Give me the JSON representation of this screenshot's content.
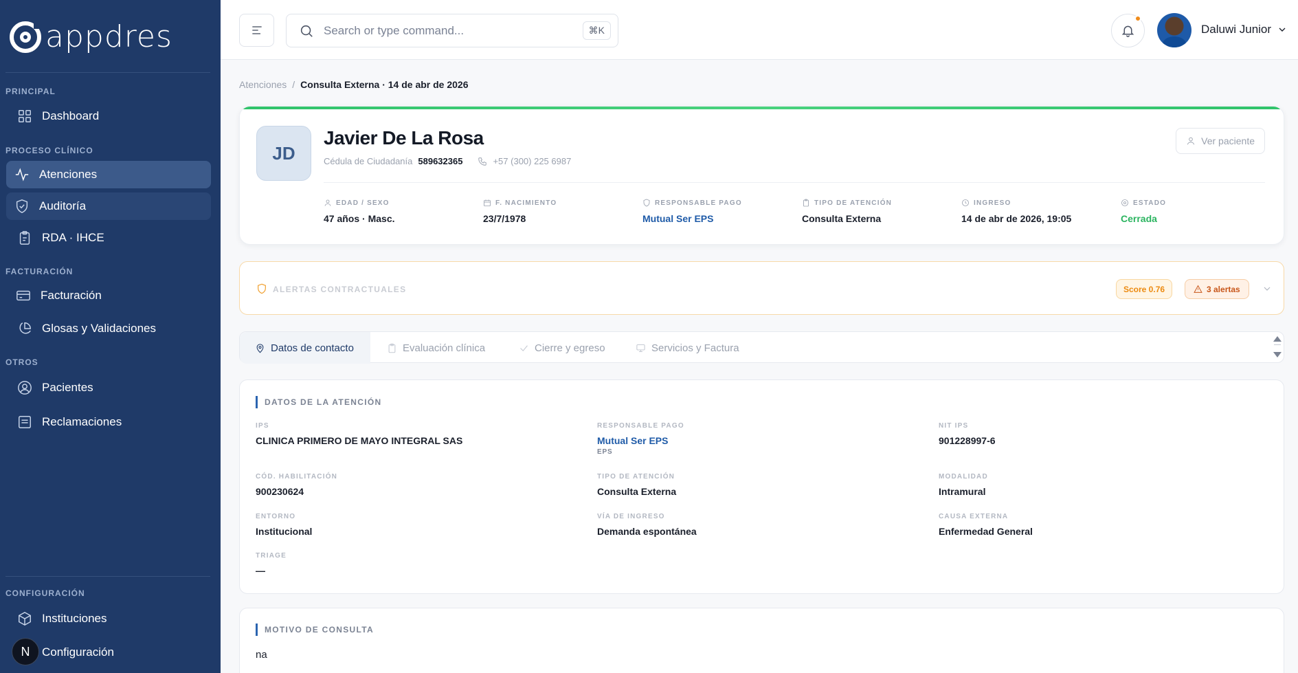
{
  "app": {
    "name": "appdres"
  },
  "sidebar": {
    "sections": {
      "principal": "PRINCIPAL",
      "proceso": "PROCESO CLÍNICO",
      "facturacion": "FACTURACIÓN",
      "otros": "OTROS",
      "config": "CONFIGURACIÓN"
    },
    "items": {
      "dashboard": "Dashboard",
      "atenciones": "Atenciones",
      "auditoria": "Auditoría",
      "rda": "RDA · IHCE",
      "facturacion": "Facturación",
      "glosas": "Glosas y Validaciones",
      "pacientes": "Pacientes",
      "reclamaciones": "Reclamaciones",
      "instituciones": "Instituciones",
      "configuracion": "Configuración"
    },
    "n_badge": "N"
  },
  "topbar": {
    "search_placeholder": "Search or type command...",
    "shortcut": "⌘K",
    "user_name": "Daluwi Junior"
  },
  "breadcrumb": {
    "parent": "Atenciones",
    "separator": "/",
    "current": "Consulta Externa · 14 de abr de 2026"
  },
  "patient": {
    "initials": "JD",
    "name": "Javier De La Rosa",
    "doc_type": "Cédula de Ciudadanía",
    "doc_number": "589632365",
    "phone": "+57 (300) 225 6987",
    "view_button": "Ver paciente",
    "fields": {
      "edad_label": "EDAD / SEXO",
      "edad_value": "47 años · Masc.",
      "nac_label": "F. NACIMIENTO",
      "nac_value": "23/7/1978",
      "resp_label": "RESPONSABLE PAGO",
      "resp_value": "Mutual Ser EPS",
      "tipo_label": "TIPO DE ATENCIÓN",
      "tipo_value": "Consulta Externa",
      "ingreso_label": "INGRESO",
      "ingreso_value": "14 de abr de 2026, 19:05",
      "estado_label": "ESTADO",
      "estado_value": "Cerrada"
    }
  },
  "alerts": {
    "title": "ALERTAS CONTRACTUALES",
    "score": "Score 0.76",
    "count": "3 alertas"
  },
  "tabs": {
    "contacto": "Datos de contacto",
    "evaluacion": "Evaluación clínica",
    "cierre": "Cierre y egreso",
    "servicios": "Servicios y Factura"
  },
  "atencion": {
    "title": "DATOS DE LA ATENCIÓN",
    "ips_label": "IPS",
    "ips_value": "CLINICA PRIMERO DE MAYO INTEGRAL SAS",
    "resp_label": "RESPONSABLE PAGO",
    "resp_value": "Mutual Ser EPS",
    "resp_sub": "EPS",
    "nit_label": "NIT IPS",
    "nit_value": "901228997-6",
    "hab_label": "CÓD. HABILITACIÓN",
    "hab_value": "900230624",
    "tipo_label": "TIPO DE ATENCIÓN",
    "tipo_value": "Consulta Externa",
    "mod_label": "MODALIDAD",
    "mod_value": "Intramural",
    "ent_label": "ENTORNO",
    "ent_value": "Institucional",
    "via_label": "VÍA DE INGRESO",
    "via_value": "Demanda espontánea",
    "causa_label": "CAUSA EXTERNA",
    "causa_value": "Enfermedad General",
    "triage_label": "TRIAGE",
    "triage_value": "—"
  },
  "motivo": {
    "title": "MOTIVO DE CONSULTA",
    "text": "na"
  },
  "colors": {
    "sidebar": "#1f3a68",
    "accent_green": "#2fc36a",
    "link_blue": "#1f5ba8",
    "warning": "#ec8a10"
  }
}
